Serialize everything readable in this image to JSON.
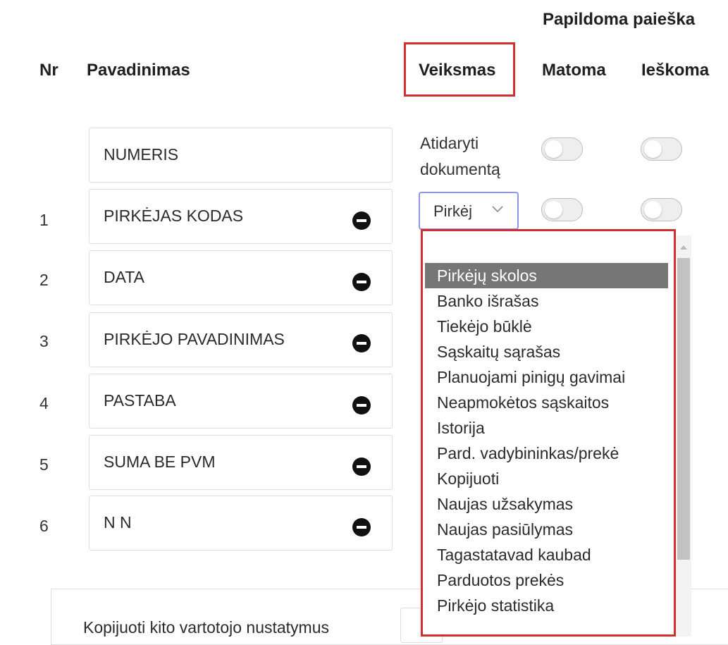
{
  "header": {
    "section_title": "Papildoma paieška",
    "col_nr": "Nr",
    "col_name": "Pavadinimas",
    "col_action": "Veiksmas",
    "col_visible": "Matoma",
    "col_search": "Ieškoma"
  },
  "rows": [
    {
      "nr": "",
      "name": "NUMERIS"
    },
    {
      "nr": "1",
      "name": "PIRKĖJAS KODAS"
    },
    {
      "nr": "2",
      "name": "DATA"
    },
    {
      "nr": "3",
      "name": "PIRKĖJO PAVADINIMAS"
    },
    {
      "nr": "4",
      "name": "PASTABA"
    },
    {
      "nr": "5",
      "name": "SUMA BE PVM"
    },
    {
      "nr": "6",
      "name": "N N"
    }
  ],
  "action": {
    "first_row_line1": "Atidaryti",
    "first_row_line2": "dokumentą",
    "select_value": "Pirkėj"
  },
  "toggles": {
    "visible": [
      false,
      false
    ],
    "search": [
      false,
      false
    ]
  },
  "dropdown": {
    "search_value": "",
    "selected_index": 0,
    "items": [
      "Pirkėjų skolos",
      "Banko išrašas",
      "Tiekėjo būklė",
      "Sąskaitų sąrašas",
      "Planuojami pinigų gavimai",
      "Neapmokėtos sąskaitos",
      "Istorija",
      "Pard. vadybininkas/prekė",
      "Kopijuoti",
      "Naujas užsakymas",
      "Naujas pasiūlymas",
      "Tagastatavad kaubad",
      "Parduotos prekės",
      "Pirkėjo statistika"
    ]
  },
  "bottom": {
    "copy_label": "Kopijuoti kito vartotojo nustatymus"
  },
  "colors": {
    "highlight_border": "#d32f2f",
    "select_focus_border": "#8f95e6",
    "selected_item_bg": "#767676"
  },
  "icons": {
    "remove": "minus-circle-icon",
    "select_arrow": "chevron-down-icon",
    "scroll_up": "scroll-up-arrow-icon"
  }
}
